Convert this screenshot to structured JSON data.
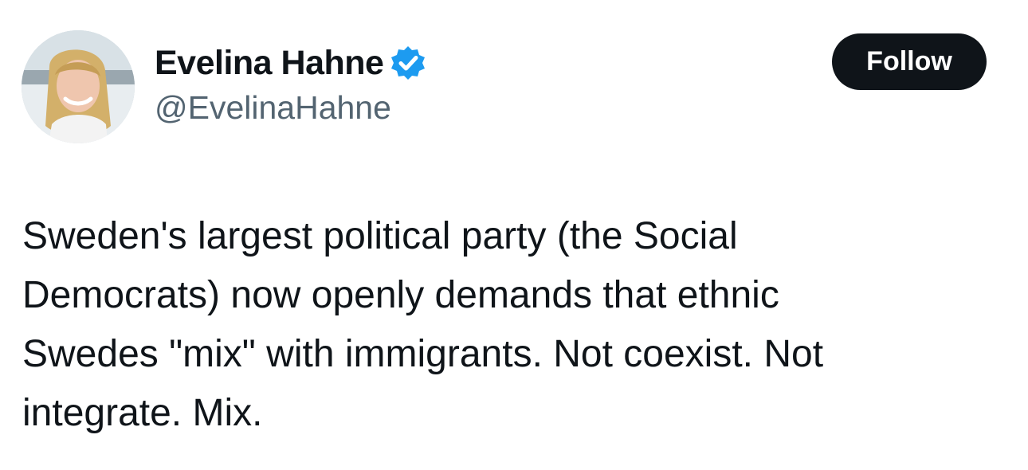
{
  "author": {
    "display_name": "Evelina Hahne",
    "handle": "@EvelinaHahne",
    "verified_icon": "verified-badge-icon",
    "avatar_icon": "profile-photo"
  },
  "actions": {
    "follow_label": "Follow"
  },
  "tweet": {
    "text": "Sweden's largest political party (the Social\nDemocrats) now openly demands that ethnic\nSwedes \"mix\" with immigrants. Not coexist. Not\nintegrate. Mix."
  },
  "colors": {
    "verified_blue": "#1d9bf0",
    "button_black": "#0f1419",
    "secondary_text": "#536471"
  }
}
